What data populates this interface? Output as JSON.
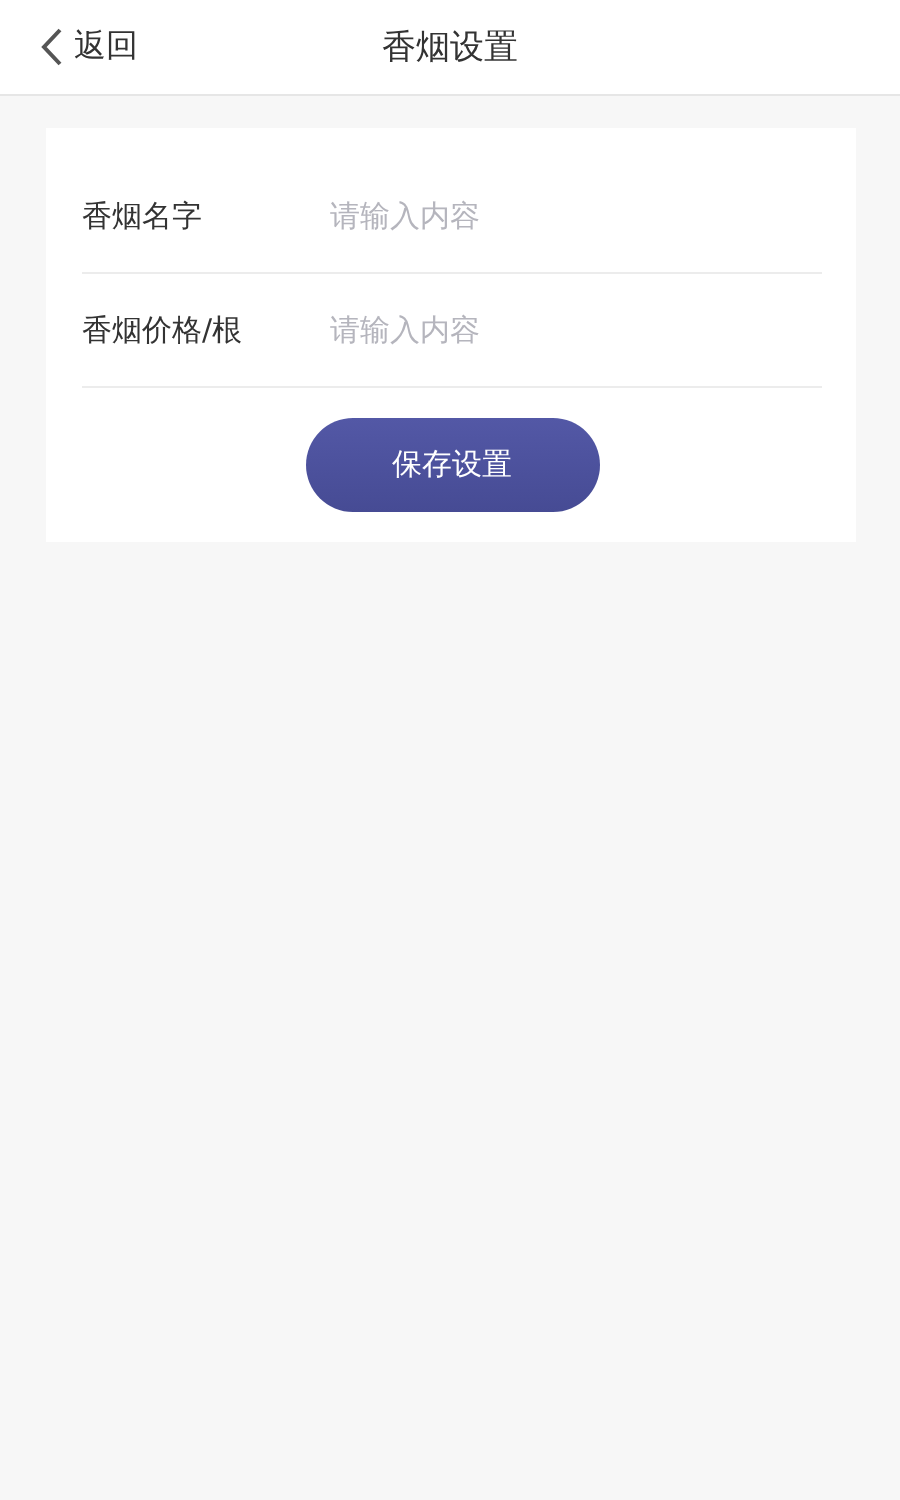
{
  "header": {
    "back_label": "返回",
    "title": "香烟设置"
  },
  "fields": [
    {
      "label": "香烟名字",
      "placeholder": "请输入内容"
    },
    {
      "label": "香烟价格/根",
      "placeholder": "请输入内容"
    }
  ],
  "save_button": "保存设置"
}
